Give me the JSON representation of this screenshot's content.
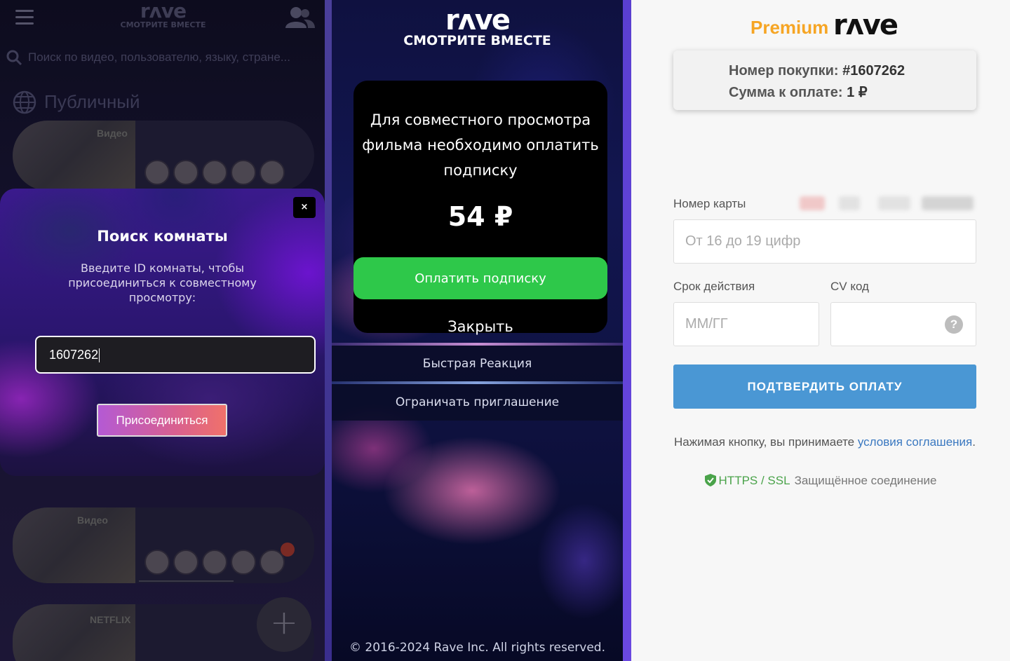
{
  "left_panel": {
    "app_logo": {
      "word": "rʌve",
      "tagline": "СМОТРИТЕ ВМЕСТЕ"
    },
    "search": {
      "placeholder": "Поиск по видео, пользователю, языку, стране..."
    },
    "section_label": "Публичный",
    "rooms": [
      {
        "source": "Видео"
      },
      {
        "source": "Видео"
      },
      {
        "source": "NETFLIX"
      }
    ],
    "join_modal": {
      "close_label": "×",
      "title": "Поиск комнаты",
      "description": "Введите ID комнаты, чтобы присоединиться к совместному просмотру:",
      "room_id_value": "1607262",
      "join_button": "Присоединиться"
    },
    "fab_label": "+"
  },
  "middle_panel": {
    "app_logo": {
      "word": "rʌve",
      "tagline": "СМОТРИТЕ ВМЕСТЕ"
    },
    "paywall": {
      "message": "Для совместного просмотра фильма необходимо оплатить подписку",
      "price": "54 ₽",
      "pay_button": "Оплатить подписку",
      "close_button": "Закрыть"
    },
    "menu": [
      "Быстрая Реакция",
      "Ограничать приглашение"
    ],
    "copyright": "© 2016-2024 Rave Inc. All rights reserved."
  },
  "right_panel": {
    "header": {
      "premium": "Premium",
      "logo": "rʌve"
    },
    "order": {
      "number_label": "Номер покупки:",
      "number_value": "#1607262",
      "amount_label": "Сумма к оплате:",
      "amount_value": "1 ₽"
    },
    "card_number": {
      "label": "Номер карты",
      "placeholder": "От 16 до 19 цифр"
    },
    "expiry": {
      "label": "Срок действия",
      "placeholder": "ММ/ГГ"
    },
    "cvv": {
      "label": "CV код",
      "help": "?"
    },
    "confirm_button": "ПОДТВЕРДИТЬ ОПЛАТУ",
    "terms": {
      "prefix": "Нажимая кнопку, вы принимаете ",
      "link": "условия соглашения",
      "suffix": "."
    },
    "security": {
      "protocol": "HTTPS / SSL",
      "label": "Защищённое соединение"
    }
  },
  "colors": {
    "premium_orange": "#f6a524",
    "confirm_blue": "#4a97d4",
    "pay_green": "#2ec84a",
    "secure_green": "#4aa34a",
    "link_blue": "#3a78c0"
  }
}
